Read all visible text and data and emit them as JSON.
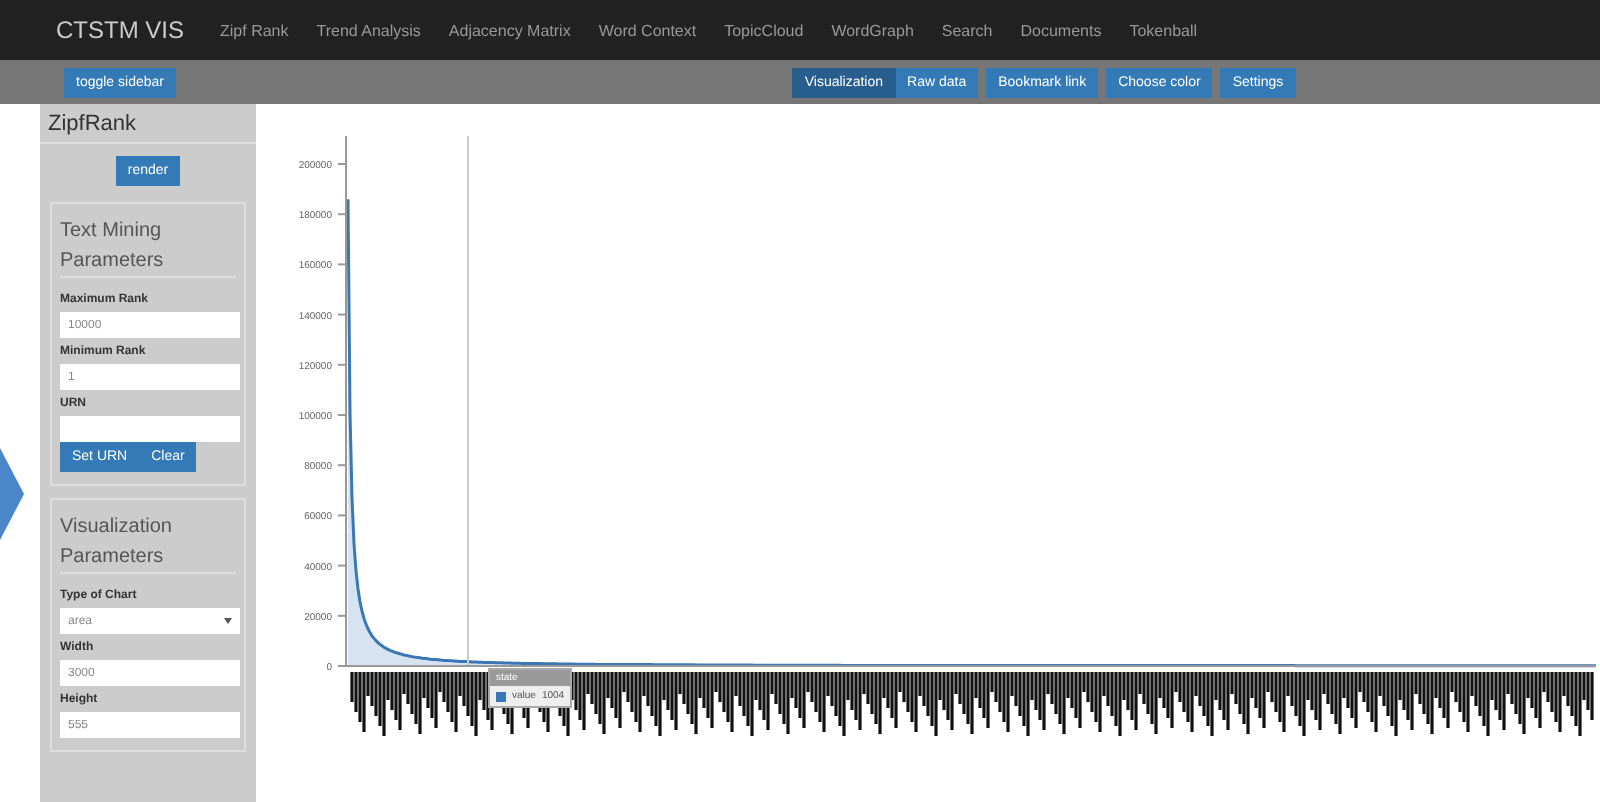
{
  "navbar": {
    "brand": "CTSTM VIS",
    "links": [
      "Zipf Rank",
      "Trend Analysis",
      "Adjacency Matrix",
      "Word Context",
      "TopicCloud",
      "WordGraph",
      "Search",
      "Documents",
      "Tokenball"
    ]
  },
  "toolbar": {
    "toggle": "toggle sidebar",
    "view_tabs": [
      {
        "label": "Visualization",
        "selected": true
      },
      {
        "label": "Raw data",
        "selected": false
      }
    ],
    "buttons": [
      "Bookmark link",
      "Choose color",
      "Settings"
    ]
  },
  "sidebar": {
    "title": "ZipfRank",
    "render": "render",
    "sections": [
      {
        "title": "Text Mining Parameters",
        "fields": [
          {
            "label": "Maximum Rank",
            "kind": "text",
            "value": "10000"
          },
          {
            "label": "Minimum Rank",
            "kind": "text",
            "value": "1"
          },
          {
            "label": "URN",
            "kind": "text"
          }
        ],
        "buttons": [
          "Set URN",
          "Clear"
        ]
      },
      {
        "title": "Visualization Parameters",
        "fields": [
          {
            "label": "Type of Chart",
            "kind": "select",
            "value": "area"
          },
          {
            "label": "Width",
            "kind": "text",
            "value": "3000"
          },
          {
            "label": "Height",
            "kind": "text",
            "value": "555"
          }
        ]
      }
    ]
  },
  "chart": {
    "y_tick_labels": [
      "200000",
      "180000",
      "160000",
      "140000",
      "120000",
      "100000",
      "80000",
      "60000",
      "40000",
      "20000",
      "0"
    ],
    "tooltip": {
      "title": "state",
      "series": "value",
      "value": "1004",
      "color": "#3a78b5"
    }
  }
}
